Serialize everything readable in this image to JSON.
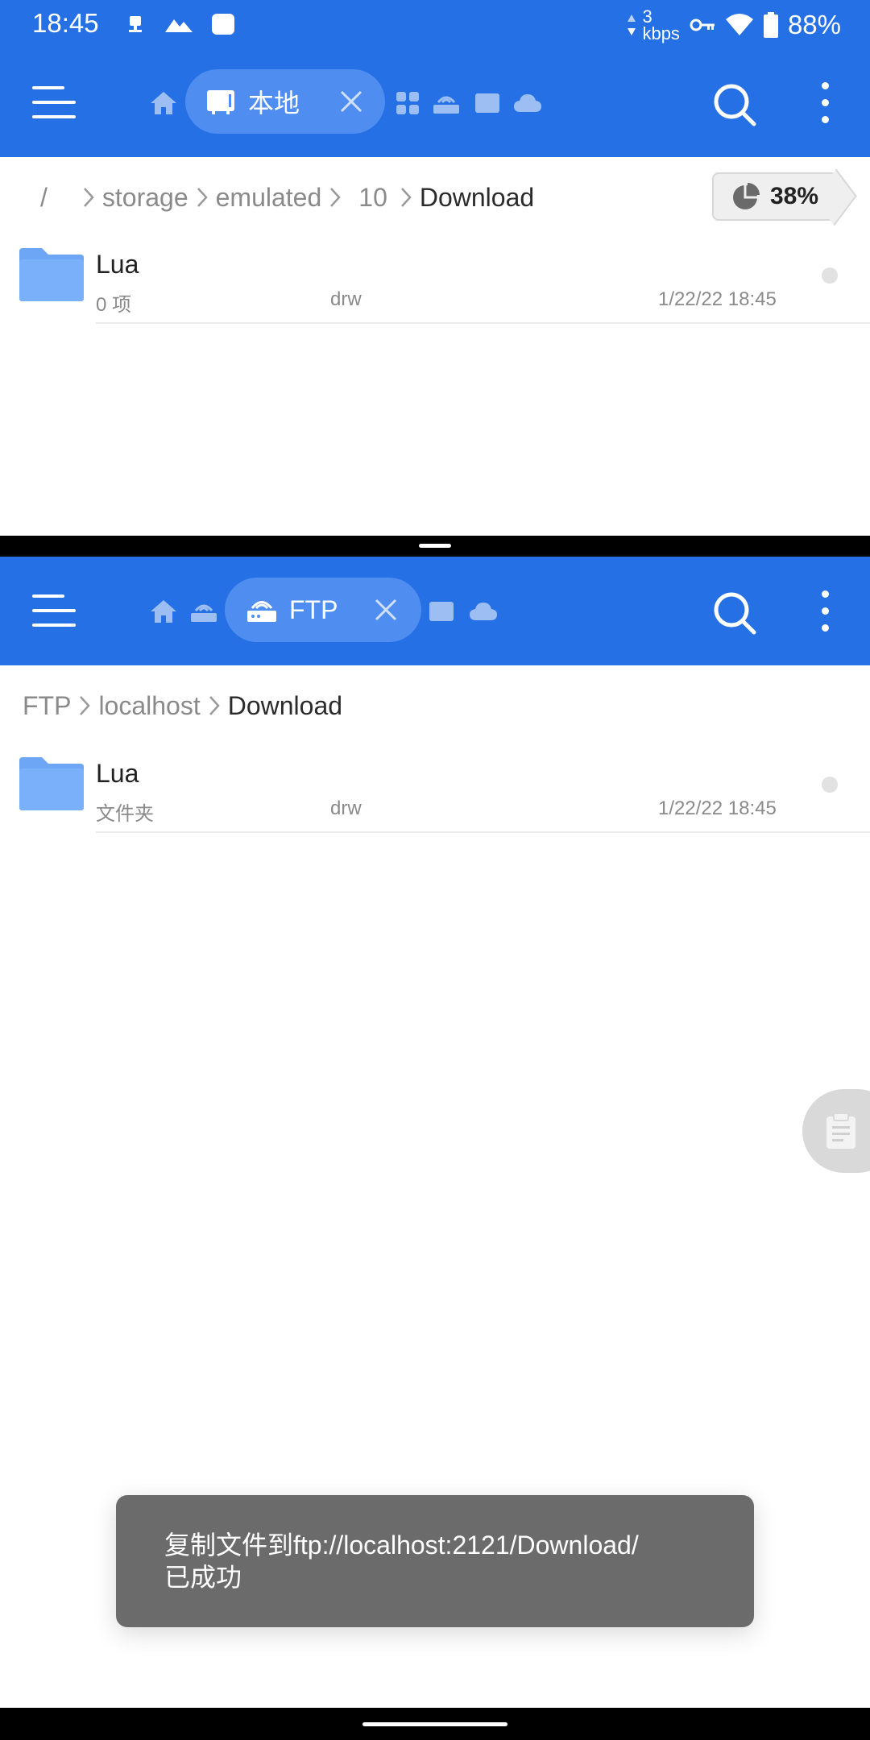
{
  "status_bar": {
    "time": "18:45",
    "net_speed_value": "3",
    "net_speed_unit": "kbps",
    "battery": "88%",
    "icons": [
      "ethernet-icon",
      "mountain-icon",
      "square-app-icon",
      "data-arrows-icon",
      "vpn-key-icon",
      "wifi-icon",
      "battery-icon"
    ]
  },
  "top_pane": {
    "active_tab_label": "本地",
    "breadcrumb": {
      "root": "/",
      "segments": [
        "storage",
        "emulated",
        "10"
      ],
      "current": "Download"
    },
    "storage_usage": "38%",
    "files": [
      {
        "name": "Lua",
        "sub": "0 项",
        "perm": "drw",
        "date": "1/22/22 18:45"
      }
    ]
  },
  "bottom_pane": {
    "active_tab_label": "FTP",
    "breadcrumb": {
      "segments": [
        "FTP",
        "localhost"
      ],
      "current": "Download"
    },
    "files": [
      {
        "name": "Lua",
        "sub": "文件夹",
        "perm": "drw",
        "date": "1/22/22 18:45"
      }
    ]
  },
  "toast": {
    "line1": "复制文件到ftp://localhost:2121/Download/",
    "line2": "已成功"
  },
  "colors": {
    "primary": "#2470e4",
    "active_tab": "#4f8ef0",
    "folder": "#6ea6f6",
    "toast_bg": "#6b6b6b"
  }
}
